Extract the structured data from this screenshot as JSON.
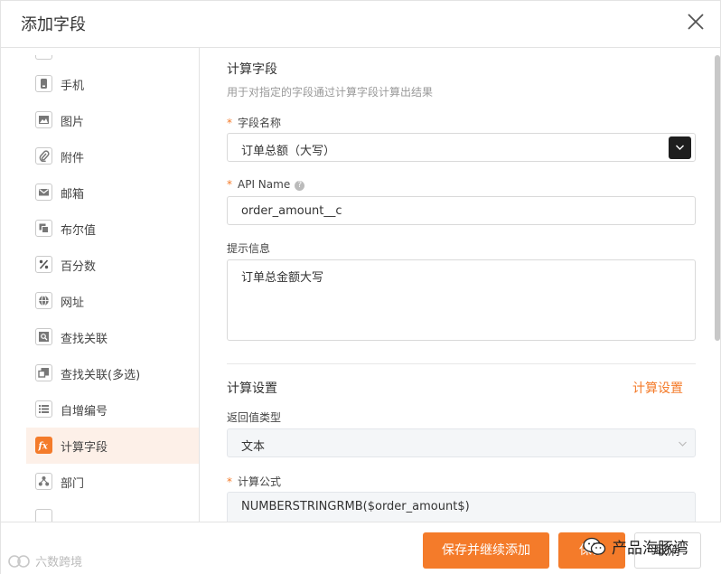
{
  "dialog": {
    "title": "添加字段"
  },
  "sidebar": {
    "items": [
      {
        "label": "手机",
        "icon": "phone-icon"
      },
      {
        "label": "图片",
        "icon": "image-icon"
      },
      {
        "label": "附件",
        "icon": "paperclip-icon"
      },
      {
        "label": "邮箱",
        "icon": "mail-icon"
      },
      {
        "label": "布尔值",
        "icon": "boolean-icon"
      },
      {
        "label": "百分数",
        "icon": "percent-icon"
      },
      {
        "label": "网址",
        "icon": "globe-icon"
      },
      {
        "label": "查找关联",
        "icon": "lookup-icon"
      },
      {
        "label": "查找关联(多选)",
        "icon": "lookup-multi-icon"
      },
      {
        "label": "自增编号",
        "icon": "list-number-icon"
      },
      {
        "label": "计算字段",
        "icon": "fx-icon",
        "active": true
      },
      {
        "label": "部门",
        "icon": "department-icon"
      }
    ]
  },
  "main": {
    "section_title": "计算字段",
    "section_desc": "用于对指定的字段通过计算字段计算出结果",
    "field_name_label": "字段名称",
    "field_name_value": "订单总额（大写）",
    "api_name_label": "API Name",
    "api_name_value": "order_amount__c",
    "hint_label": "提示信息",
    "hint_value": "订单总金额大写",
    "calc_settings_title": "计算设置",
    "calc_settings_link": "计算设置",
    "return_type_label": "返回值类型",
    "return_type_value": "文本",
    "formula_label": "计算公式",
    "formula_value": "NUMBERSTRINGRMB($order_amount$)"
  },
  "footer": {
    "save_continue_label": "保存并继续添加",
    "save_label": "保存",
    "cancel_label": "取消"
  },
  "watermarks": {
    "left": "六数跨境",
    "right": "产品海豚湾"
  },
  "colors": {
    "accent": "#f47b2a",
    "active_bg": "#fdf0e8"
  }
}
